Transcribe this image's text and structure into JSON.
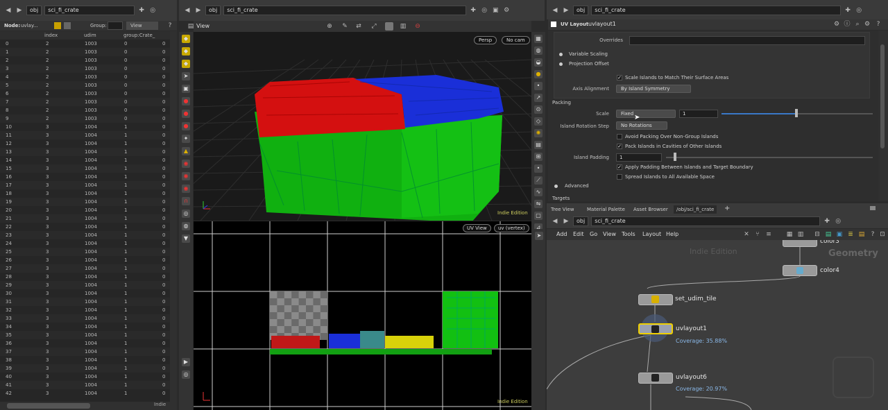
{
  "spreadsheet": {
    "path": "obj",
    "node_name": "sci_fi_crate",
    "node_label": "Node:",
    "node_value": "uvlay...",
    "group_label": "Group:",
    "view_label": "View",
    "columns": [
      "index",
      "udim",
      "group:Crate_"
    ],
    "rows": [
      [
        "0",
        "2",
        "1003",
        "0",
        "0"
      ],
      [
        "1",
        "2",
        "1003",
        "0",
        "0"
      ],
      [
        "2",
        "2",
        "1003",
        "0",
        "0"
      ],
      [
        "3",
        "2",
        "1003",
        "0",
        "0"
      ],
      [
        "4",
        "2",
        "1003",
        "0",
        "0"
      ],
      [
        "5",
        "2",
        "1003",
        "0",
        "0"
      ],
      [
        "6",
        "2",
        "1003",
        "0",
        "0"
      ],
      [
        "7",
        "2",
        "1003",
        "0",
        "0"
      ],
      [
        "8",
        "2",
        "1003",
        "0",
        "0"
      ],
      [
        "9",
        "2",
        "1003",
        "0",
        "0"
      ],
      [
        "10",
        "3",
        "1004",
        "1",
        "0"
      ],
      [
        "11",
        "3",
        "1004",
        "1",
        "0"
      ],
      [
        "12",
        "3",
        "1004",
        "1",
        "0"
      ],
      [
        "13",
        "3",
        "1004",
        "1",
        "0"
      ],
      [
        "14",
        "3",
        "1004",
        "1",
        "0"
      ],
      [
        "15",
        "3",
        "1004",
        "1",
        "0"
      ],
      [
        "16",
        "3",
        "1004",
        "1",
        "0"
      ],
      [
        "17",
        "3",
        "1004",
        "1",
        "0"
      ],
      [
        "18",
        "3",
        "1004",
        "1",
        "0"
      ],
      [
        "19",
        "3",
        "1004",
        "1",
        "0"
      ],
      [
        "20",
        "3",
        "1004",
        "1",
        "0"
      ],
      [
        "21",
        "3",
        "1004",
        "1",
        "0"
      ],
      [
        "22",
        "3",
        "1004",
        "1",
        "0"
      ],
      [
        "23",
        "3",
        "1004",
        "1",
        "0"
      ],
      [
        "24",
        "3",
        "1004",
        "1",
        "0"
      ],
      [
        "25",
        "3",
        "1004",
        "1",
        "0"
      ],
      [
        "26",
        "3",
        "1004",
        "1",
        "0"
      ],
      [
        "27",
        "3",
        "1004",
        "1",
        "0"
      ],
      [
        "28",
        "3",
        "1004",
        "1",
        "0"
      ],
      [
        "29",
        "3",
        "1004",
        "1",
        "0"
      ],
      [
        "30",
        "3",
        "1004",
        "1",
        "0"
      ],
      [
        "31",
        "3",
        "1004",
        "1",
        "0"
      ],
      [
        "32",
        "3",
        "1004",
        "1",
        "0"
      ],
      [
        "33",
        "3",
        "1004",
        "1",
        "0"
      ],
      [
        "34",
        "3",
        "1004",
        "1",
        "0"
      ],
      [
        "35",
        "3",
        "1004",
        "1",
        "0"
      ],
      [
        "36",
        "3",
        "1004",
        "1",
        "0"
      ],
      [
        "37",
        "3",
        "1004",
        "1",
        "0"
      ],
      [
        "38",
        "3",
        "1004",
        "1",
        "0"
      ],
      [
        "39",
        "3",
        "1004",
        "1",
        "0"
      ],
      [
        "40",
        "3",
        "1004",
        "1",
        "0"
      ],
      [
        "41",
        "3",
        "1004",
        "1",
        "0"
      ],
      [
        "42",
        "3",
        "1004",
        "1",
        "0"
      ]
    ],
    "footer": "Indie"
  },
  "viewport": {
    "path": "obj",
    "node_name": "sci_fi_crate",
    "title": "View",
    "persp": "Persp",
    "cam": "No cam",
    "uv_view": "UV View",
    "uv_attr": "uv (vertex)",
    "edition_top": "Indie Edition",
    "edition_bottom": "Indie Edition"
  },
  "params": {
    "path": "obj",
    "node_name": "sci_fi_crate",
    "type_label": "UV Layout",
    "node": "uvlayout1",
    "overrides_label": "Overrides",
    "variable_scaling": "Variable Scaling",
    "projection_offset": "Projection Offset",
    "scale_islands": "Scale Islands to Match Their Surface Areas",
    "axis_alignment_label": "Axis Alignment",
    "axis_alignment_value": "By Island Symmetry",
    "packing_header": "Packing",
    "scale_label": "Scale",
    "scale_mode": "Fixed",
    "scale_value": "1",
    "rotation_label": "Island Rotation Step",
    "rotation_value": "No Rotations",
    "avoid_packing": "Avoid Packing Over Non-Group Islands",
    "pack_cavities": "Pack Islands in Cavities of Other Islands",
    "padding_label": "Island Padding",
    "padding_value": "1",
    "apply_padding": "Apply Padding Between Islands and Target Boundary",
    "spread_islands": "Spread Islands to All Available Space",
    "advanced": "Advanced",
    "targets": "Targets"
  },
  "tabs": [
    "Tree View",
    "Material Palette",
    "Asset Browser",
    "/obj/sci_fi_crate"
  ],
  "network": {
    "path": "obj",
    "node_name": "sci_fi_crate",
    "menu": [
      "Add",
      "Edit",
      "Go",
      "View",
      "Tools",
      "Layout",
      "Help"
    ],
    "watermark_edition": "Indie Edition",
    "watermark_context": "Geometry",
    "nodes": {
      "color3": "color3",
      "color4": "color4",
      "set_udim_tile": "set_udim_tile",
      "uvlayout1": "uvlayout1",
      "uvlayout1_cov": "Coverage: 35.88%",
      "uvlayout6": "uvlayout6",
      "uvlayout6_cov": "Coverage: 20.97%"
    }
  },
  "colors": {
    "red": "#d01010",
    "blue": "#1a2fd8",
    "green": "#12c012",
    "yellow": "#d8d20a",
    "select": "#f0d000"
  }
}
